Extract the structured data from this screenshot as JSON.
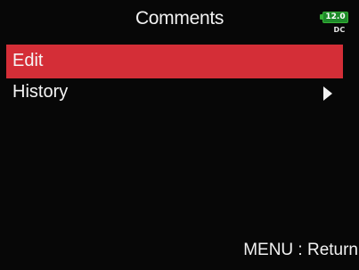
{
  "header": {
    "title": "Comments",
    "battery_level": "12.0",
    "power_source": "DC"
  },
  "menu": {
    "items": [
      {
        "label": "Edit",
        "selected": true,
        "has_submenu": false
      },
      {
        "label": "History",
        "selected": false,
        "has_submenu": true
      }
    ]
  },
  "footer": {
    "hint": "MENU : Return"
  },
  "colors": {
    "background": "#070707",
    "selection": "#d42e37",
    "battery": "#1e8a2a"
  }
}
